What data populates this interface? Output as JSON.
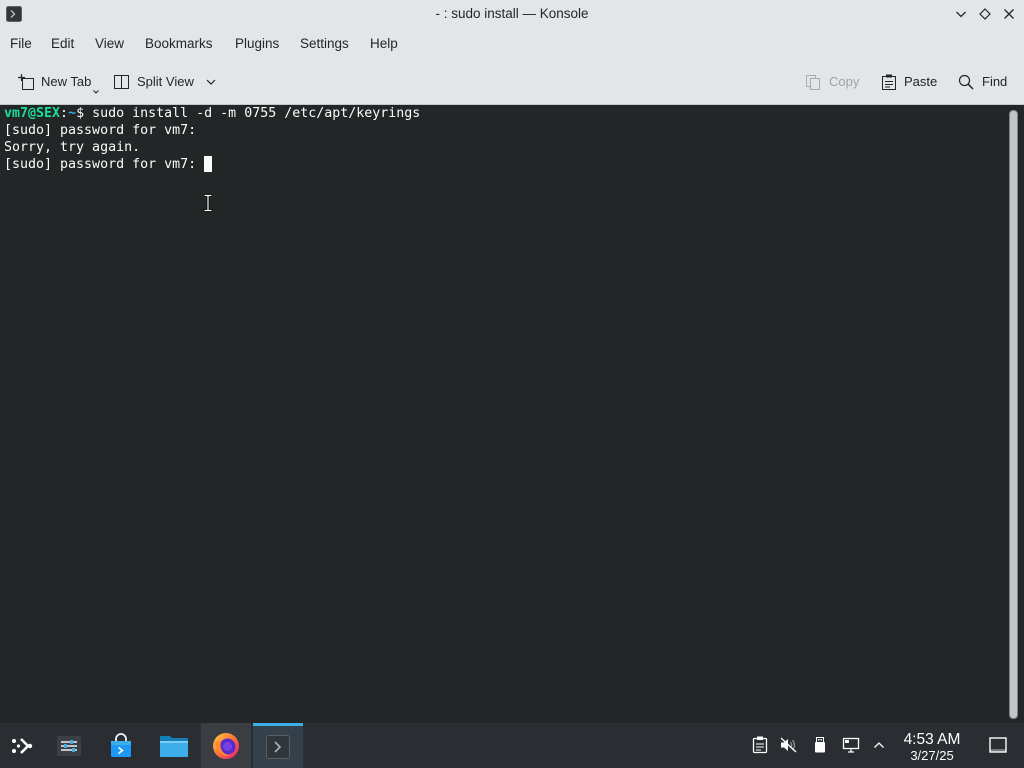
{
  "window": {
    "title": "- : sudo install — Konsole",
    "app_icon": "konsole-icon",
    "controls": {
      "minimize": "chevron-down-icon",
      "maximize": "diamond-icon",
      "close": "close-icon"
    }
  },
  "menu": {
    "items": [
      "File",
      "Edit",
      "View",
      "Bookmarks",
      "Plugins",
      "Settings",
      "Help"
    ]
  },
  "toolbar": {
    "new_tab": {
      "label": "New Tab",
      "icon": "tab-new-icon"
    },
    "split_view": {
      "label": "Split View",
      "icon": "split-view-icon"
    },
    "copy": {
      "label": "Copy",
      "icon": "copy-icon",
      "enabled": false
    },
    "paste": {
      "label": "Paste",
      "icon": "paste-icon"
    },
    "find": {
      "label": "Find",
      "icon": "search-icon"
    }
  },
  "terminal": {
    "prompt": {
      "user_host": "vm7@SEX",
      "separator": ":",
      "path": "~",
      "symbol": "$"
    },
    "command": "sudo install -d -m 0755 /etc/apt/keyrings",
    "output": [
      "[sudo] password for vm7:",
      "Sorry, try again.",
      "[sudo] password for vm7:"
    ]
  },
  "taskbar": {
    "launcher_icon": "application-launcher-icon",
    "tasks": [
      {
        "icon": "system-settings-icon"
      },
      {
        "icon": "discover-icon"
      },
      {
        "icon": "folder-icon"
      },
      {
        "icon": "firefox-icon"
      },
      {
        "icon": "konsole-icon",
        "active": true
      }
    ],
    "tray": [
      "clipboard-icon",
      "volume-muted-icon",
      "removable-device-icon",
      "network-wired-icon",
      "chevron-up-icon"
    ],
    "clock": {
      "time": "4:53 AM",
      "date": "3/27/25"
    },
    "show_desktop_icon": "show-desktop-icon"
  },
  "colors": {
    "terminal_bg": "#232627",
    "terminal_fg": "#fcfcfc",
    "prompt_user": "#1cdc9a",
    "prompt_path": "#3daee9",
    "accent": "#3daee9",
    "chrome_bg": "#e3e5e7",
    "taskbar_bg": "#2a2e32",
    "disabled_text": "#a0a2a4"
  }
}
